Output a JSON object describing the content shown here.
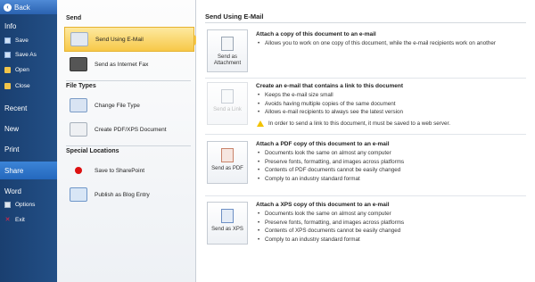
{
  "nav": {
    "back_label": "Back",
    "items": [
      {
        "label": "Info",
        "type": "big"
      },
      {
        "label": "Save",
        "type": "small",
        "icon": "save-icon"
      },
      {
        "label": "Save As",
        "type": "small",
        "icon": "save-as-icon"
      },
      {
        "label": "Open",
        "type": "small",
        "icon": "open-folder-icon"
      },
      {
        "label": "Close",
        "type": "small",
        "icon": "close-folder-icon"
      },
      {
        "label": "Recent",
        "type": "big"
      },
      {
        "label": "New",
        "type": "big"
      },
      {
        "label": "Print",
        "type": "big"
      },
      {
        "label": "Share",
        "type": "big",
        "active": true
      },
      {
        "label": "Word",
        "type": "big"
      },
      {
        "label": "Options",
        "type": "small",
        "icon": "options-icon"
      },
      {
        "label": "Exit",
        "type": "small",
        "icon": "exit-icon"
      }
    ]
  },
  "middle": {
    "send_heading": "Send",
    "send_items": [
      {
        "label": "Send Using E-Mail",
        "icon": "email-icon",
        "selected": true
      },
      {
        "label": "Send as Internet Fax",
        "icon": "fax-icon"
      }
    ],
    "filetypes_heading": "File Types",
    "filetypes_items": [
      {
        "label": "Change File Type",
        "icon": "file-type-icon"
      },
      {
        "label": "Create PDF/XPS Document",
        "icon": "pdf-xps-icon"
      }
    ],
    "special_heading": "Special Locations",
    "special_items": [
      {
        "label": "Save to SharePoint",
        "icon": "sharepoint-icon"
      },
      {
        "label": "Publish as Blog Entry",
        "icon": "blog-icon"
      }
    ]
  },
  "right": {
    "title": "Send Using E-Mail",
    "options": [
      {
        "tile_label": "Send as Attachment",
        "heading": "Attach a copy of this document to an e-mail",
        "bullets": [
          "Allows you to work on one copy of this document, while the e-mail recipients work on another"
        ],
        "disabled": false
      },
      {
        "tile_label": "Send a Link",
        "heading": "Create an e-mail that contains a link to this document",
        "bullets": [
          "Keeps the e-mail size small",
          "Avoids having multiple copies of the same document",
          "Allows e-mail recipients to always see the latest version"
        ],
        "warning": "In order to send a link to this document, it must be saved to a web server.",
        "disabled": true
      },
      {
        "tile_label": "Send as PDF",
        "heading": "Attach a PDF copy of this document to an e-mail",
        "bullets": [
          "Documents look the same on almost any computer",
          "Preserve fonts, formatting, and images across platforms",
          "Contents of PDF documents cannot be easily changed",
          "Comply to an industry standard format"
        ],
        "disabled": false
      },
      {
        "tile_label": "Send as XPS",
        "heading": "Attach a XPS copy of this document to an e-mail",
        "bullets": [
          "Documents look the same on almost any computer",
          "Preserve fonts, formatting, and images across platforms",
          "Contents of XPS documents cannot be easily changed",
          "Comply to an industry standard format"
        ],
        "disabled": false
      }
    ]
  }
}
